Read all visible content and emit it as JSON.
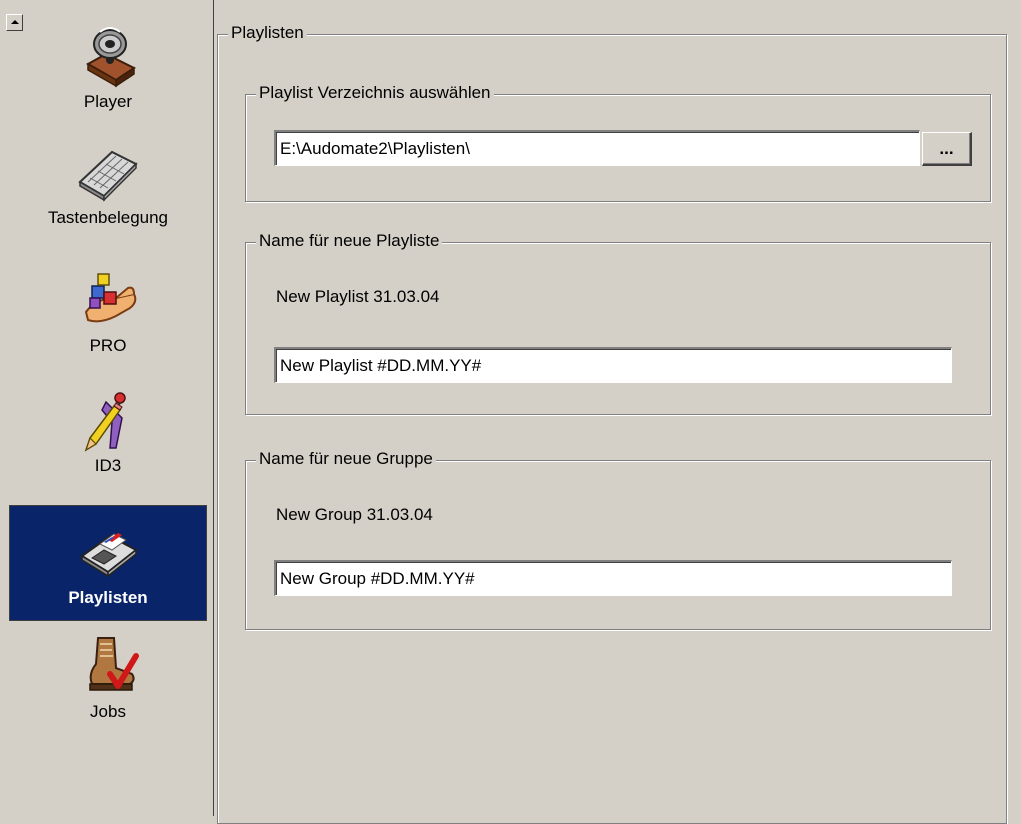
{
  "sidebar": {
    "items": [
      {
        "label": "Player",
        "icon": "gramophone-icon"
      },
      {
        "label": "Tastenbelegung",
        "icon": "keyboard-icon"
      },
      {
        "label": "PRO",
        "icon": "hand-blocks-icon"
      },
      {
        "label": "ID3",
        "icon": "pencil-figure-icon"
      },
      {
        "label": "Playlisten",
        "icon": "floppy-disk-icon",
        "selected": true
      },
      {
        "label": "Jobs",
        "icon": "boot-checkmark-icon"
      }
    ],
    "selected_color": "#0a246a"
  },
  "panel": {
    "title": "Playlisten",
    "directory_group": {
      "legend": "Playlist Verzeichnis auswählen",
      "path_value": "E:\\Audomate2\\Playlisten\\",
      "browse_label": "..."
    },
    "playlist_name_group": {
      "legend": "Name für neue Playliste",
      "preview": "New Playlist 31.03.04",
      "pattern_value": "New Playlist #DD.MM.YY#"
    },
    "group_name_group": {
      "legend": "Name für neue Gruppe",
      "preview": "New Group 31.03.04",
      "pattern_value": "New Group #DD.MM.YY#"
    }
  }
}
